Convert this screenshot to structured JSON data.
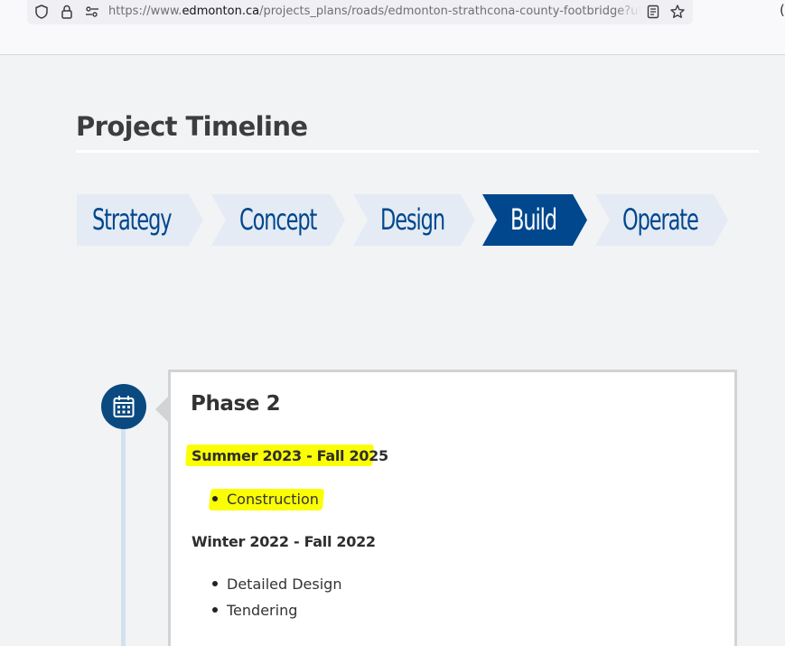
{
  "browser": {
    "url_prefix": "https://www.",
    "url_host": "edmonton.ca",
    "url_path": "/projects_plans/roads/edmonton-strathcona-county-footbridge?utm_s",
    "edge_glyph": "("
  },
  "page": {
    "title": "Project Timeline"
  },
  "stages": [
    {
      "label": "Strategy",
      "active": false
    },
    {
      "label": "Concept",
      "active": false
    },
    {
      "label": "Design",
      "active": false
    },
    {
      "label": "Build",
      "active": true
    },
    {
      "label": "Operate",
      "active": false
    }
  ],
  "timeline": {
    "phase_title": "Phase 2",
    "periods": [
      {
        "heading": "Summer 2023 - Fall 2025",
        "highlighted": true,
        "tasks": [
          "Construction"
        ]
      },
      {
        "heading": "Winter 2022 - Fall 2022",
        "highlighted": false,
        "tasks": [
          "Detailed Design",
          "Tendering"
        ]
      }
    ]
  },
  "colors": {
    "page_bg": "#f2f3f5",
    "stage_bg": "#e4ebf4",
    "stage_active_bg": "#00478e",
    "stage_text": "#00478e",
    "marker_bg": "#0a4a80",
    "highlight": "#fbfd04"
  },
  "icons": [
    "shield-icon",
    "lock-icon",
    "permissions-icon",
    "reader-view-icon",
    "bookmark-star-icon",
    "calendar-icon"
  ]
}
